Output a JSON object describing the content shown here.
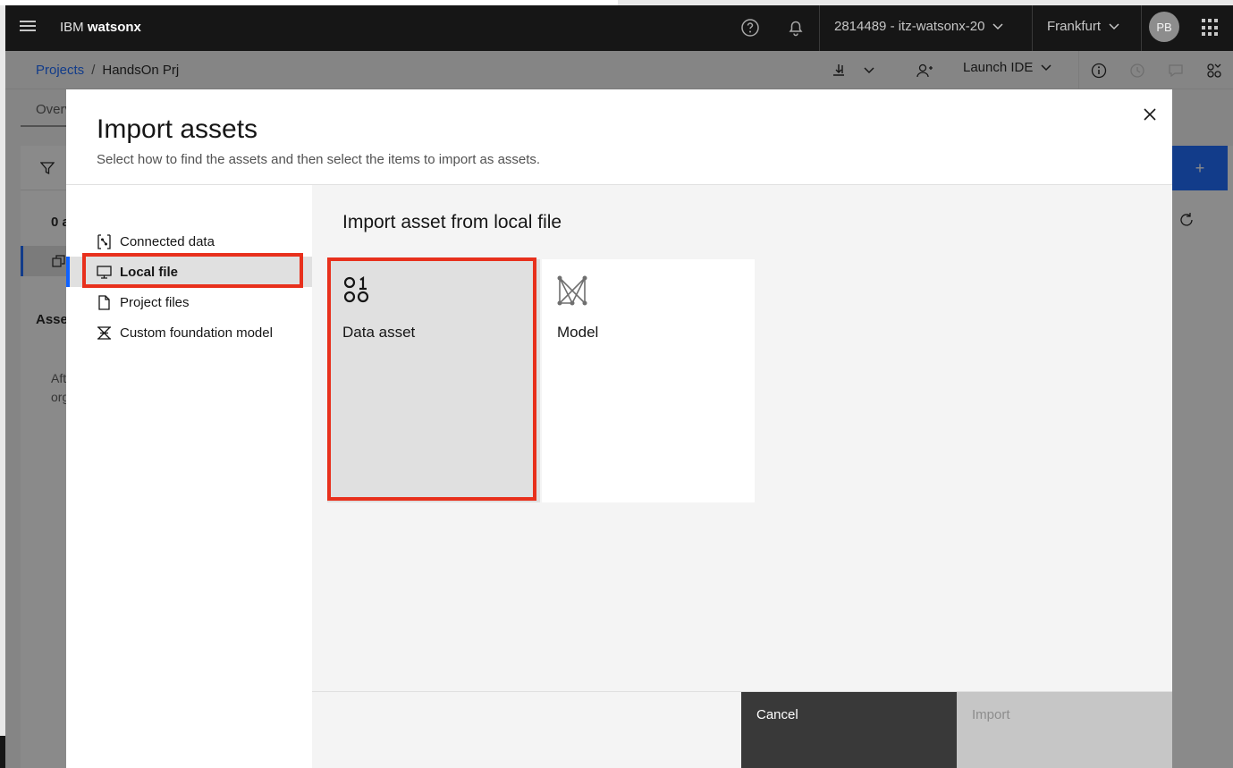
{
  "topbar": {
    "brand_prefix": "IBM",
    "brand_name": "watsonx",
    "account": "2814489 - itz-watsonx-20",
    "region": "Frankfurt",
    "avatar_initials": "PB"
  },
  "subbar": {
    "breadcrumb": [
      "Projects",
      "/",
      "HandsOn Prj"
    ],
    "launch_ide": "Launch IDE"
  },
  "background_page": {
    "tab_overview": "Overview",
    "asset_count": "0 a",
    "assets_heading": "Asse",
    "after_text_1": "Aft",
    "after_text_2": "org",
    "add_symbol": "+"
  },
  "modal": {
    "title": "Import assets",
    "subtitle": "Select how to find the assets and then select the items to import as assets.",
    "sidebar": [
      {
        "label": "Connected data",
        "icon": "connected-data-icon"
      },
      {
        "label": "Local file",
        "icon": "desktop-icon",
        "active": true
      },
      {
        "label": "Project files",
        "icon": "document-icon"
      },
      {
        "label": "Custom foundation model",
        "icon": "foundation-model-icon"
      }
    ],
    "content_title": "Import asset from local file",
    "tiles": [
      {
        "label": "Data asset",
        "icon": "data-asset-icon",
        "selected": true
      },
      {
        "label": "Model",
        "icon": "model-icon"
      }
    ],
    "cancel_label": "Cancel",
    "import_label": "Import"
  },
  "colors": {
    "accent": "#0f62fe",
    "highlight": "#e8301c",
    "topbar_bg": "#161616"
  }
}
